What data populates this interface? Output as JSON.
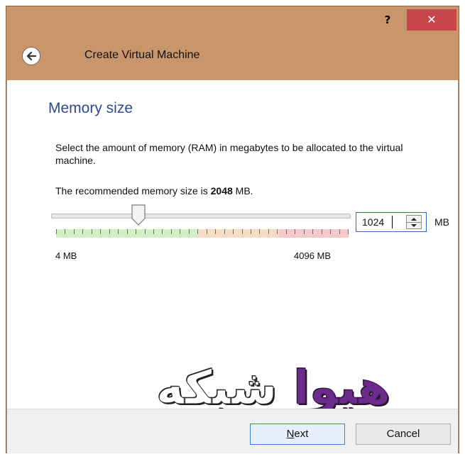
{
  "titlebar": {
    "help_label": "?",
    "close_label": "✕"
  },
  "header": {
    "title": "Create Virtual Machine",
    "back_icon": "back-arrow-icon"
  },
  "section": {
    "title": "Memory size",
    "description": "Select the amount of memory (RAM) in megabytes to be allocated to the virtual machine.",
    "recommended_prefix": "The recommended memory size is ",
    "recommended_value": "2048",
    "recommended_suffix": " MB."
  },
  "memory": {
    "min_label": "4 MB",
    "max_label": "4096 MB",
    "value": "1024",
    "unit": "MB",
    "slider_fraction": 0.25
  },
  "watermark": {
    "accent": "هیوا",
    "rest": " شبکه"
  },
  "footer": {
    "next_label_first": "N",
    "next_label_rest": "ext",
    "cancel_label": "Cancel"
  },
  "colors": {
    "frame": "#c9956a",
    "close": "#c7464c",
    "title": "#2f4a8f",
    "zone_green": "#d2f0c6",
    "zone_orange": "#f7dcc6",
    "zone_red": "#f6c9cc"
  }
}
